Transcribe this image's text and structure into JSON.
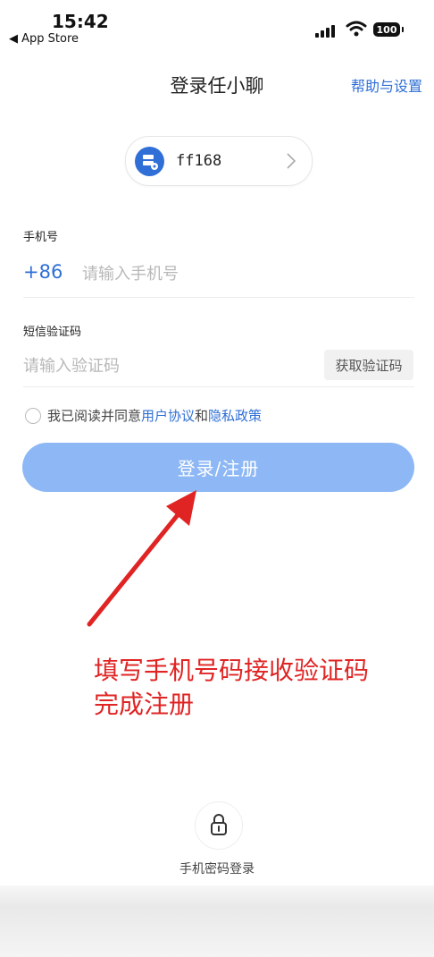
{
  "status_bar": {
    "time": "15:42",
    "back_label": "◀ App Store",
    "battery": "100"
  },
  "header": {
    "title": "登录任小聊",
    "help_link": "帮助与设置"
  },
  "server": {
    "name": "ff168",
    "icon": "server-icon",
    "accent": "#2f6fd6"
  },
  "phone": {
    "label": "手机号",
    "prefix": "+86",
    "placeholder": "请输入手机号",
    "value": ""
  },
  "code": {
    "label": "短信验证码",
    "placeholder": "请输入验证码",
    "value": "",
    "get_code_label": "获取验证码"
  },
  "agreement": {
    "prefix": "我已阅读并同意",
    "user_agreement": "用户协议",
    "and": "和",
    "privacy_policy": "隐私政策",
    "checked": false
  },
  "login_button": {
    "label": "登录/注册",
    "color": "#8db7f5"
  },
  "annotation": {
    "line1": "填写手机号码接收验证码",
    "line2": "完成注册",
    "color": "#e02424"
  },
  "password_login": {
    "label": "手机密码登录",
    "icon": "lock-icon"
  }
}
